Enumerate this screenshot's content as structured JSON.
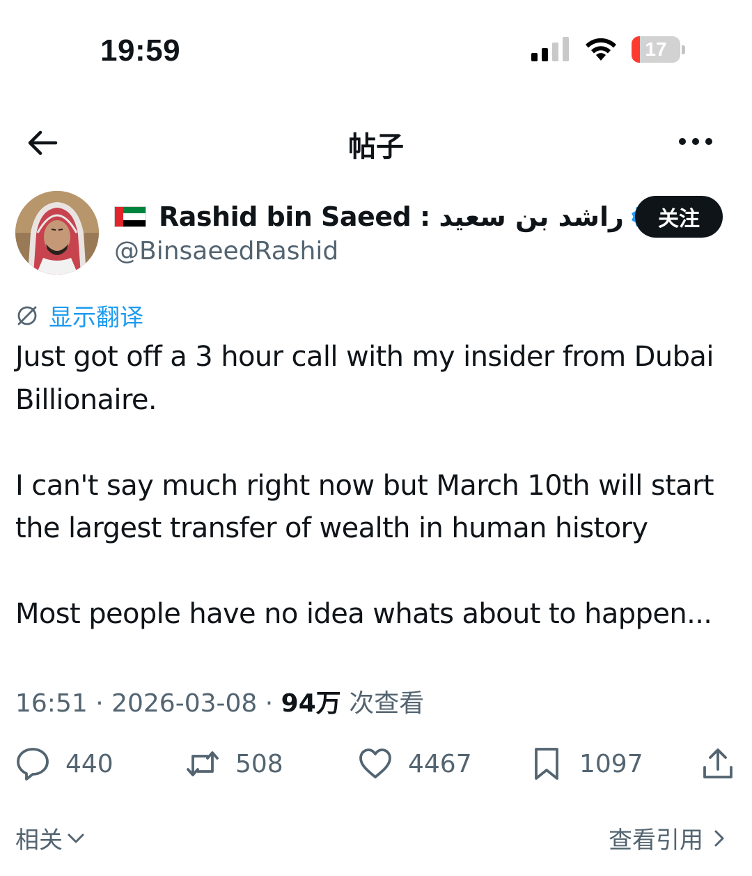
{
  "status_bar": {
    "time": "19:59",
    "battery_level": "17",
    "battery_fraction": 0.17,
    "icons": [
      "cellular-signal-icon",
      "wifi-icon",
      "battery-icon"
    ]
  },
  "nav": {
    "title": "帖子",
    "back_icon": "arrow-left-icon",
    "more_icon": "more-dots-icon"
  },
  "author": {
    "flag_icon": "uae-flag-icon",
    "display_name": "Rashid bin Saeed : راشد بن سعيد",
    "verified_icon": "verified-badge-icon",
    "handle": "@BinsaeedRashid",
    "follow_label": "关注"
  },
  "translate": {
    "label": "显示翻译",
    "icon": "translate-globe-icon"
  },
  "tweet": {
    "text": "Just got off a 3 hour call with my insider from Dubai Billionaire.\n\nI can't say much right now but March 10th will start the largest transfer of wealth in human history\n\nMost people have no idea whats about to happen..."
  },
  "meta": {
    "time": "16:51",
    "sep1": " · ",
    "date": "2026-03-08",
    "sep2": " · ",
    "views_count": "94万",
    "views_label": " 次查看"
  },
  "actions": {
    "replies": "440",
    "retweets": "508",
    "likes": "4467",
    "bookmarks": "1097"
  },
  "footer": {
    "related_label": "相关",
    "quotes_label": "查看引用"
  },
  "colors": {
    "accent": "#1d9bf0",
    "text": "#0f1419",
    "secondary": "#536471",
    "battery_low": "#ff3b30"
  }
}
